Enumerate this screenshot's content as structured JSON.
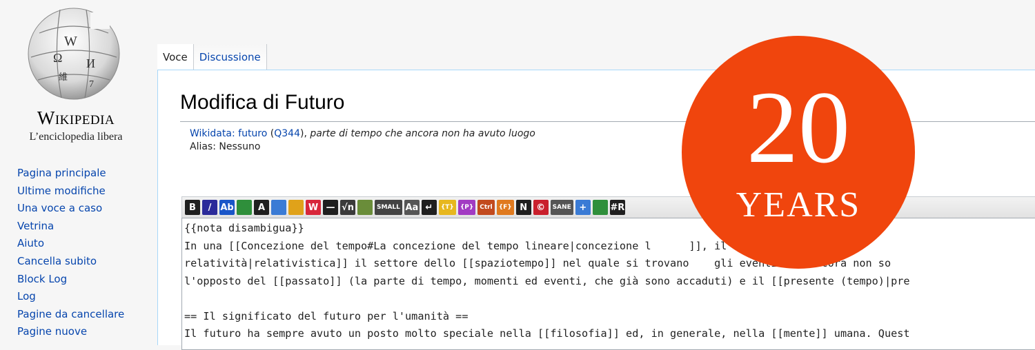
{
  "logo": {
    "wordmark": "Wikipedia",
    "tagline": "L’enciclopedia libera"
  },
  "sidebar": {
    "items": [
      {
        "label": "Pagina principale"
      },
      {
        "label": "Ultime modifiche"
      },
      {
        "label": "Una voce a caso"
      },
      {
        "label": "Vetrina"
      },
      {
        "label": "Aiuto"
      },
      {
        "label": "Cancella subito"
      },
      {
        "label": "Block Log"
      },
      {
        "label": "Log"
      },
      {
        "label": "Pagine da cancellare"
      },
      {
        "label": "Pagine nuove"
      }
    ]
  },
  "tabs": [
    {
      "label": "Voce",
      "selected": true
    },
    {
      "label": "Discussione",
      "selected": false
    }
  ],
  "page": {
    "title": "Modifica di Futuro",
    "wikidata_prefix": "Wikidata:",
    "wikidata_item": "futuro",
    "wikidata_id": "Q344",
    "wikidata_description": "parte di tempo che ancora non ha avuto luogo",
    "alias": "Alias: Nessuno"
  },
  "toolbar": {
    "buttons": [
      {
        "icon": "bold-icon",
        "label": "B",
        "color": "#1f1f1f"
      },
      {
        "icon": "italic-icon",
        "label": "/",
        "color": "#2b2b9a"
      },
      {
        "icon": "internal-link-icon",
        "label": "Ab",
        "color": "#1a56c8"
      },
      {
        "icon": "external-link-icon",
        "label": "",
        "color": "#2f8f3b"
      },
      {
        "icon": "heading-icon",
        "label": "A",
        "color": "#1f1f1f"
      },
      {
        "icon": "image-icon",
        "label": "",
        "color": "#3a7bd5"
      },
      {
        "icon": "media-icon",
        "label": "",
        "color": "#e0a21a"
      },
      {
        "icon": "nowiki-icon",
        "label": "W",
        "color": "#d8263a"
      },
      {
        "icon": "hr-icon",
        "label": "—",
        "color": "#1f1f1f"
      },
      {
        "icon": "math-icon",
        "label": "√n",
        "color": "#3b3b3b"
      },
      {
        "icon": "tools-icon",
        "label": "",
        "color": "#6a8d3a"
      },
      {
        "icon": "small-text-icon",
        "label": "SMALL",
        "color": "#444"
      },
      {
        "icon": "case-icon",
        "label": "Aa",
        "color": "#555"
      },
      {
        "icon": "newline-icon",
        "label": "↵",
        "color": "#1f1f1f"
      },
      {
        "icon": "template-icon",
        "label": "{T}",
        "color": "#e7b71f"
      },
      {
        "icon": "p-template-icon",
        "label": "{P}",
        "color": "#a23bc3"
      },
      {
        "icon": "ctrl-icon",
        "label": "Ctrl",
        "color": "#c24a1e"
      },
      {
        "icon": "f-template-icon",
        "label": "{F}",
        "color": "#e07a1f"
      },
      {
        "icon": "n-icon",
        "label": "N",
        "color": "#1f1f1f"
      },
      {
        "icon": "copyright-icon",
        "label": "©",
        "color": "#c91f2c"
      },
      {
        "icon": "sane-icon",
        "label": "SANE",
        "color": "#555"
      },
      {
        "icon": "plus-icon",
        "label": "+",
        "color": "#3a7bd5"
      },
      {
        "icon": "table-icon",
        "label": "",
        "color": "#2f8f3b"
      },
      {
        "icon": "redirect-icon",
        "label": "#R",
        "color": "#1f1f1f"
      }
    ]
  },
  "editor": {
    "lines": [
      "{{nota disambigua}}",
      "In una [[Concezione del tempo#La concezione del tempo lineare|concezione l      ]], il '''futuro''' è la",
      "relatività|relativistica]] il settore dello [[spaziotempo]] nel quale si trovano    gli eventi che ancora non so",
      "l'opposto del [[passato]] (la parte di tempo, momenti ed eventi, che già sono accaduti) e il [[presente (tempo)|pre",
      "",
      "== Il significato del futuro per l'umanità ==",
      "Il futuro ha sempre avuto un posto molto speciale nella [[filosofia]] ed, in generale, nella [[mente]] umana. Quest"
    ]
  },
  "badge": {
    "number": "20",
    "word": "YEARS",
    "color": "#f0450d"
  }
}
